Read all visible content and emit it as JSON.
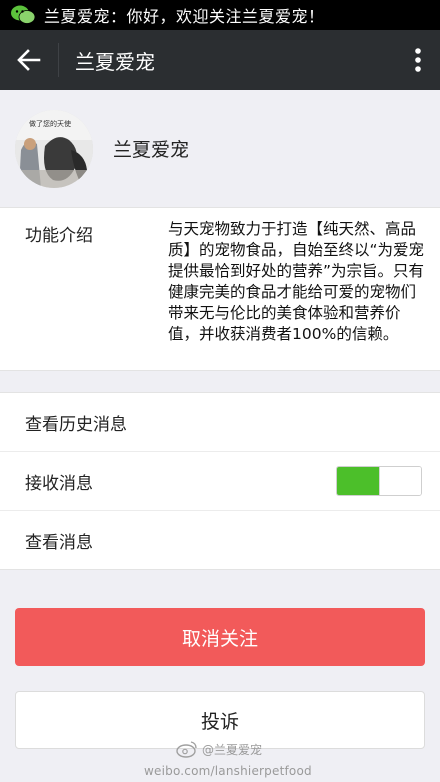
{
  "status_bar": {
    "notification_text": "兰夏爱宠：你好，欢迎关注兰夏爱宠！",
    "icon": "wechat-icon"
  },
  "header": {
    "title": "兰夏爱宠",
    "back_icon": "arrow-left-icon",
    "menu_icon": "more-vertical-icon"
  },
  "profile": {
    "name": "兰夏爱宠",
    "avatar_caption": "做了您的天使"
  },
  "intro": {
    "label": "功能介绍",
    "description": "与天宠物致力于打造【纯天然、高品质】的宠物食品，自始至终以“为爱宠提供最恰到好处的营养”为宗旨。只有健康完美的食品才能给可爱的宠物们带来无与伦比的美食体验和营养价值，并收获消费者100%的信赖。"
  },
  "options": {
    "history": "查看历史消息",
    "receive": "接收消息",
    "receive_enabled": true,
    "view": "查看消息"
  },
  "buttons": {
    "unfollow": "取消关注",
    "report": "投诉"
  },
  "watermark": {
    "handle": "@兰夏爱宠",
    "url": "weibo.com/lanshierpetfood"
  },
  "colors": {
    "action_bar": "#2b2e31",
    "unfollow_button": "#f25a5a",
    "toggle_on": "#4cbf2a",
    "background": "#efeff4"
  }
}
